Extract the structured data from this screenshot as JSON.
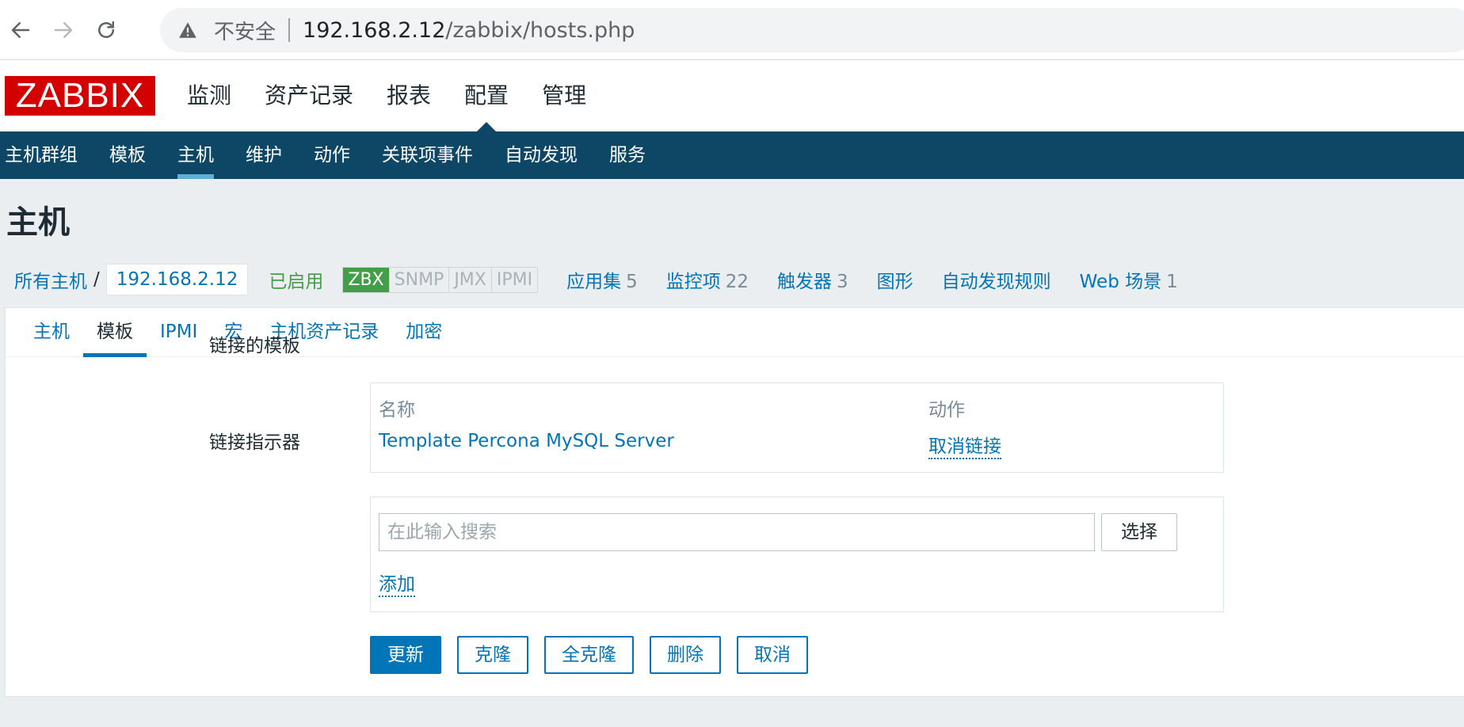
{
  "browser": {
    "insecure_label": "不安全",
    "url_host": "192.168.2.12",
    "url_path": "/zabbix/hosts.php"
  },
  "logo_text": "ZABBIX",
  "main_menu": [
    "监测",
    "资产记录",
    "报表",
    "配置",
    "管理"
  ],
  "main_menu_selected": "配置",
  "sub_menu": [
    "主机群组",
    "模板",
    "主机",
    "维护",
    "动作",
    "关联项事件",
    "自动发现",
    "服务"
  ],
  "sub_menu_selected": "主机",
  "page_title": "主机",
  "host_nav": {
    "all_hosts": "所有主机",
    "separator": "/",
    "current_host": "192.168.2.12",
    "status": "已启用",
    "availability": [
      "ZBX",
      "SNMP",
      "JMX",
      "IPMI"
    ],
    "applications_label": "应用集",
    "applications_count": "5",
    "items_label": "监控项",
    "items_count": "22",
    "triggers_label": "触发器",
    "triggers_count": "3",
    "graphs_label": "图形",
    "discovery_label": "自动发现规则",
    "web_label": "Web 场景",
    "web_count": "1"
  },
  "tabs": [
    "主机",
    "模板",
    "IPMI",
    "宏",
    "主机资产记录",
    "加密"
  ],
  "tab_selected": "模板",
  "linked_templates": {
    "label": "链接的模板",
    "col_name": "名称",
    "col_action": "动作",
    "rows": [
      {
        "name": "Template Percona MySQL Server",
        "action": "取消链接"
      }
    ]
  },
  "link_indicator": {
    "label": "链接指示器",
    "placeholder": "在此输入搜索",
    "select_label": "选择",
    "add_label": "添加"
  },
  "buttons": {
    "update": "更新",
    "clone": "克隆",
    "full_clone": "全克隆",
    "delete": "删除",
    "cancel": "取消"
  }
}
